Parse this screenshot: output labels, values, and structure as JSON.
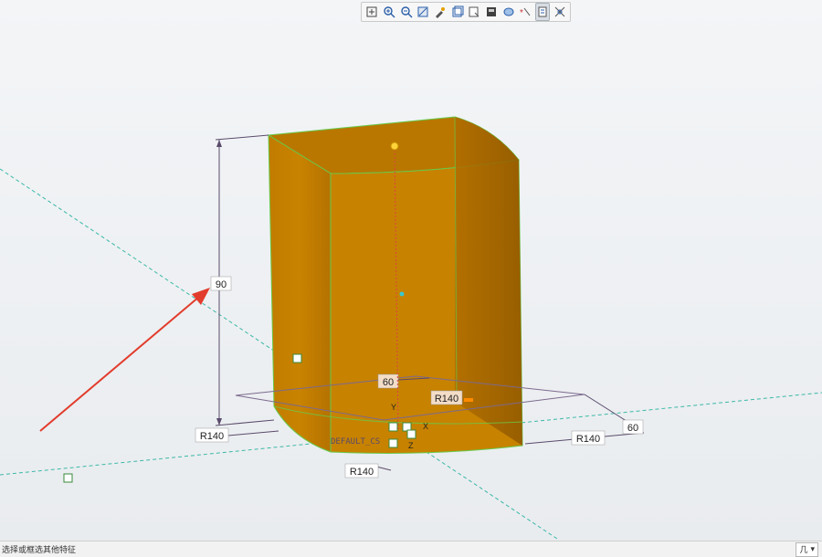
{
  "toolbar": {
    "tools": [
      {
        "icon": "refit-icon"
      },
      {
        "icon": "zoom-in-icon"
      },
      {
        "icon": "zoom-out-icon"
      },
      {
        "icon": "repaint-icon"
      },
      {
        "icon": "display-style-icon"
      },
      {
        "icon": "saved-views-icon"
      },
      {
        "icon": "view-manager-icon"
      },
      {
        "icon": "datum-display-icon"
      },
      {
        "icon": "spin-center-icon"
      },
      {
        "icon": "annotation-display-icon"
      },
      {
        "icon": "feature-toggle-icon"
      },
      {
        "icon": "sketch-view-icon"
      }
    ]
  },
  "model": {
    "body_color": "#c98400",
    "edge_color": "#69c94a"
  },
  "dimensions": {
    "height": "90",
    "depth": "60",
    "width_right": "60",
    "radius_top": "R140",
    "radius_left": "R140",
    "radius_right": "R140",
    "radius_bottom": "R140"
  },
  "csys": {
    "label": "DEFAULT_CS",
    "x": "X",
    "y": "Y",
    "z": "Z"
  },
  "status": {
    "message": "选择或框选其他特征",
    "filter_value": "几"
  }
}
